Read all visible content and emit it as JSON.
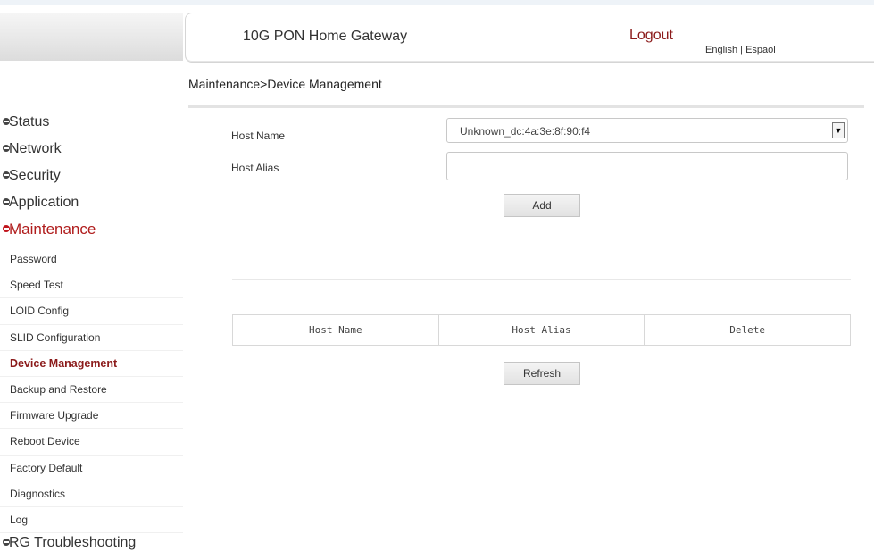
{
  "header": {
    "title": "10G PON Home Gateway",
    "logout": "Logout",
    "lang_english": "English",
    "lang_sep": " | ",
    "lang_spanish": "Espaol"
  },
  "breadcrumb": "Maintenance>Device Management",
  "sidebar": {
    "top_items": [
      "Status",
      "Network",
      "Security",
      "Application",
      "Maintenance"
    ],
    "sub_items": [
      "Password",
      "Speed Test",
      "LOID Config",
      "SLID Configuration",
      "Device Management",
      "Backup and Restore",
      "Firmware Upgrade",
      "Reboot Device",
      "Factory Default",
      "Diagnostics",
      "Log"
    ],
    "bottom_item": "RG Troubleshooting",
    "active_top": "Maintenance",
    "active_sub": "Device Management"
  },
  "form": {
    "host_name_label": "Host Name",
    "host_name_value": "Unknown_dc:4a:3e:8f:90:f4",
    "host_alias_label": "Host Alias",
    "host_alias_value": "",
    "add_label": "Add"
  },
  "table": {
    "headers": [
      "Host Name",
      "Host Alias",
      "Delete"
    ],
    "rows": []
  },
  "refresh_label": "Refresh",
  "colors": {
    "accent": "#8b1a1a",
    "active_bullet": "#c0141c"
  }
}
